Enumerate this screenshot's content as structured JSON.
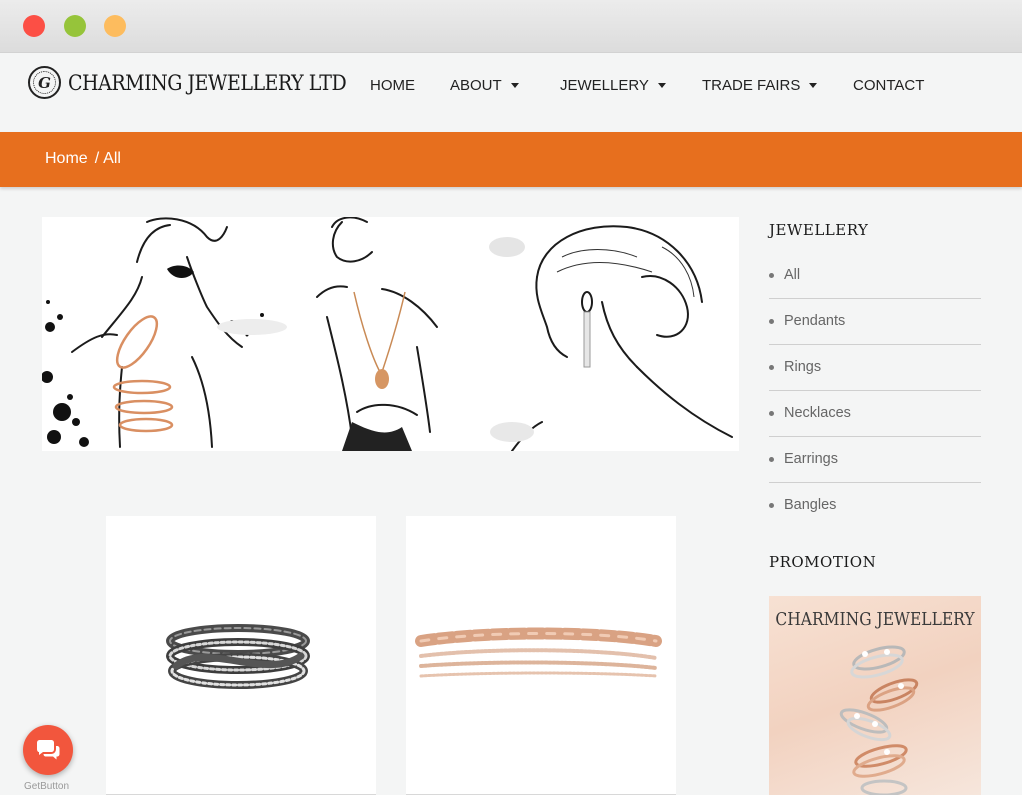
{
  "colors": {
    "accent": "#e76f1e",
    "page_bg": "#f4f5f5",
    "chat": "#f2563d"
  },
  "window": {
    "buttons": [
      "close",
      "minimize",
      "zoom"
    ]
  },
  "brand": {
    "monogram": "G",
    "name": "CHARMING JEWELLERY LTD"
  },
  "nav": {
    "items": [
      {
        "label": "HOME",
        "dropdown": false
      },
      {
        "label": "ABOUT",
        "dropdown": true
      },
      {
        "label": "JEWELLERY",
        "dropdown": true
      },
      {
        "label": "TRADE FAIRS",
        "dropdown": true
      },
      {
        "label": "CONTACT",
        "dropdown": false
      }
    ]
  },
  "breadcrumb": {
    "home": "Home",
    "separator": "/",
    "current": "All"
  },
  "sidebar": {
    "jewellery_title": "JEWELLERY",
    "categories": [
      "All",
      "Pendants",
      "Rings",
      "Necklaces",
      "Earrings",
      "Bangles"
    ],
    "promotion_title": "PROMOTION",
    "promo_banner_text": "CHARMING JEWELLERY"
  },
  "products": [
    {
      "image": "stacked-black-rhodium-ring"
    },
    {
      "image": "rose-gold-chain-bracelet"
    }
  ],
  "chat_widget": {
    "label": "GetButton",
    "icon": "chat-bubbles-icon"
  }
}
